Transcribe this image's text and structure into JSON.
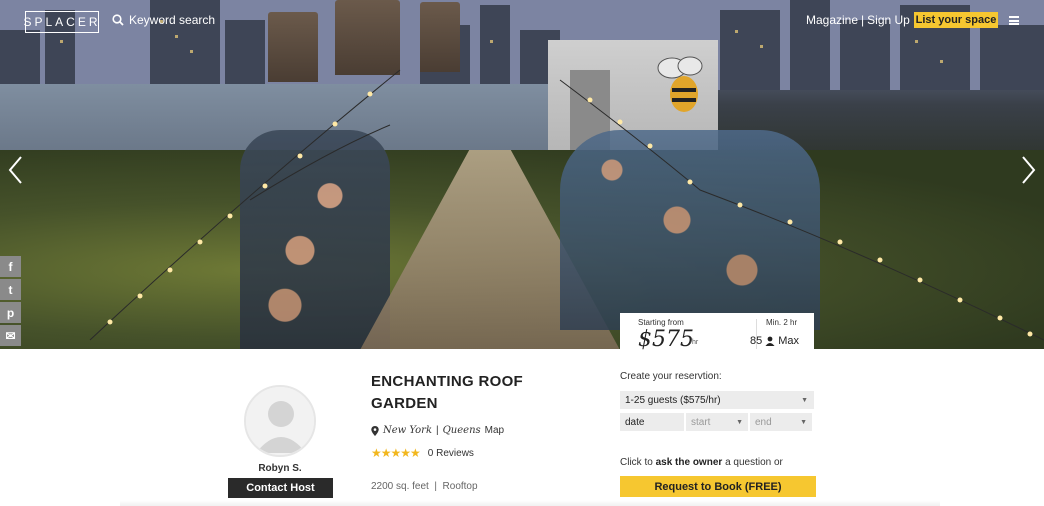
{
  "nav": {
    "logo": "SPLACER",
    "search_placeholder": "Keyword search",
    "magazine": "Magazine",
    "separator": "|",
    "signup": "Sign Up",
    "list_space": "List your space"
  },
  "social": [
    {
      "icon": "facebook-icon",
      "glyph": "f"
    },
    {
      "icon": "twitter-icon",
      "glyph": "t"
    },
    {
      "icon": "pinterest-icon",
      "glyph": "p"
    },
    {
      "icon": "email-icon",
      "glyph": "✉"
    }
  ],
  "price_card": {
    "starting_from": "Starting from",
    "price": "$575",
    "unit": "/hr",
    "minimum": "Min. 2 hr",
    "max_guests": "85",
    "max_label": "Max"
  },
  "host": {
    "name": "Robyn S.",
    "contact_label": "Contact Host"
  },
  "listing": {
    "title": "ENCHANTING ROOF GARDEN",
    "city": "New York",
    "divider": "|",
    "borough": "Queens",
    "map_link": "Map",
    "star_count": 5,
    "reviews": "0 Reviews",
    "meta": "2200 sq. feet  |  Rooftop"
  },
  "booking": {
    "heading": "Create your reservtion:",
    "guests_value": "1-25 guests ($575/hr)",
    "date_label": "date",
    "start_placeholder": "start",
    "end_placeholder": "end",
    "ask_prefix": "Click to",
    "ask_bold": "ask the owner",
    "ask_suffix": "a question or",
    "request_label": "Request to Book (FREE)"
  },
  "colors": {
    "accent_yellow": "#f6c730",
    "star_gold": "#f2b71e",
    "dark_button": "#2a2a2a"
  }
}
